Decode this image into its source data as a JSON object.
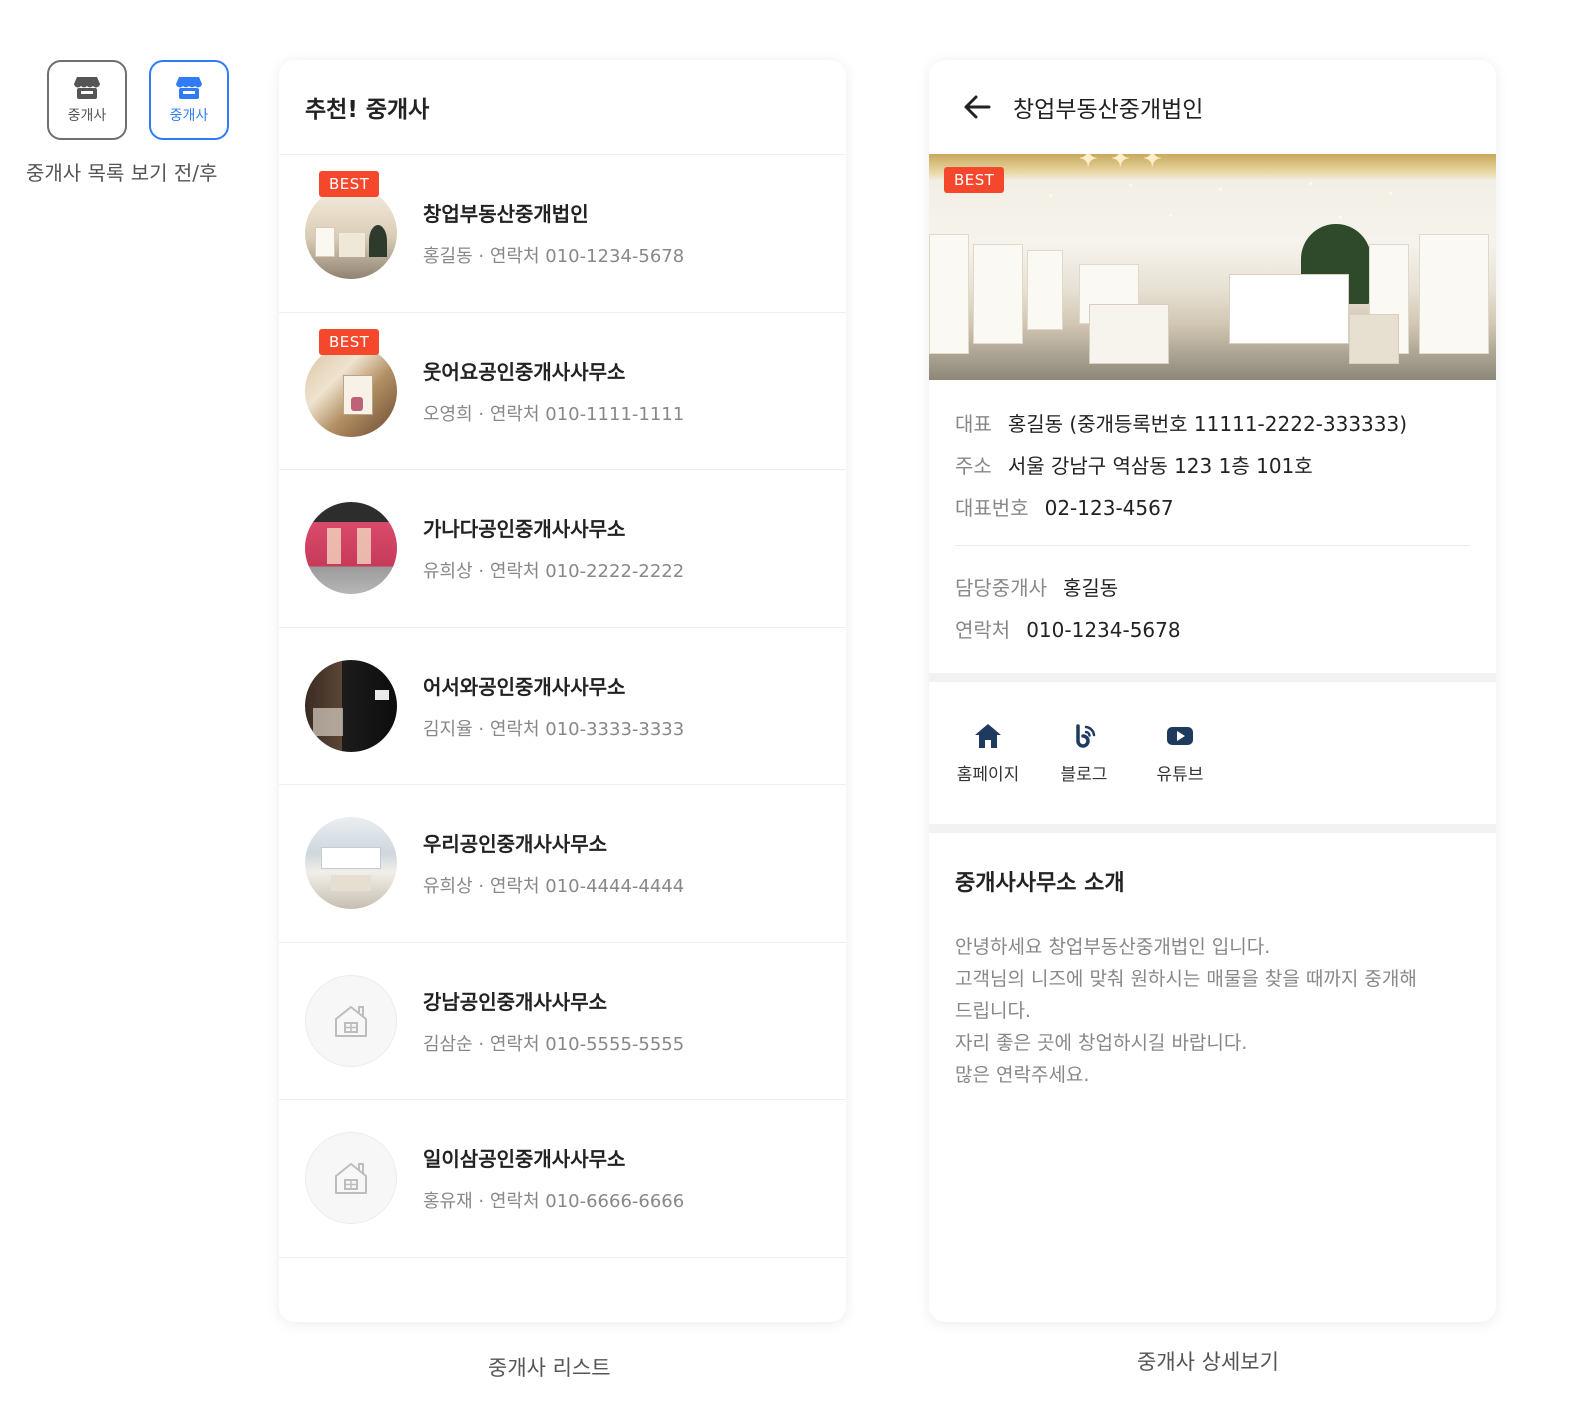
{
  "toggle": {
    "before_label": "중개사",
    "after_label": "중개사",
    "caption": "중개사 목록 보기 전/후",
    "icon": "store-icon",
    "active_color": "#2f7cf6"
  },
  "list_panel": {
    "title": "추천! 중개사",
    "caption": "중개사 리스트",
    "badge": "BEST",
    "badge_color": "#f5472c",
    "agents": [
      {
        "name": "창업부동산중개법인",
        "sub": "홍길동 · 연락처 010-1234-5678",
        "best": true
      },
      {
        "name": "웃어요공인중개사사무소",
        "sub": "오영희 · 연락처 010-1111-1111",
        "best": true
      },
      {
        "name": "가나다공인중개사사무소",
        "sub": "유희상 · 연락처 010-2222-2222",
        "best": false
      },
      {
        "name": "어서와공인중개사사무소",
        "sub": "김지율 · 연락처 010-3333-3333",
        "best": false
      },
      {
        "name": "우리공인중개사사무소",
        "sub": "유희상 · 연락처 010-4444-4444",
        "best": false
      },
      {
        "name": "강남공인중개사사무소",
        "sub": "김삼순 · 연락처 010-5555-5555",
        "best": false
      },
      {
        "name": "일이삼공인중개사사무소",
        "sub": "홍유재 · 연락처 010-6666-6666",
        "best": false
      }
    ]
  },
  "detail_panel": {
    "title": "창업부동산중개법인",
    "caption": "중개사 상세보기",
    "badge": "BEST",
    "info": {
      "rep_label": "대표",
      "rep_value": "홍길동 (중개등록번호 11111-2222-333333)",
      "addr_label": "주소",
      "addr_value": "서울 강남구 역삼동 123 1층 101호",
      "phone_label": "대표번호",
      "phone_value": "02-123-4567",
      "agent_label": "담당중개사",
      "agent_value": "홍길동",
      "contact_label": "연락처",
      "contact_value": "010-1234-5678"
    },
    "links": [
      {
        "label": "홈페이지",
        "icon": "home-icon"
      },
      {
        "label": "블로그",
        "icon": "blog-icon"
      },
      {
        "label": "유튜브",
        "icon": "youtube-icon"
      }
    ],
    "intro": {
      "title": "중개사사무소 소개",
      "lines": [
        "안녕하세요 창업부동산중개법인 입니다.",
        "고객님의 니즈에 맞춰 원하시는 매물을 찾을 때까지 중개해",
        "드립니다.",
        "자리 좋은 곳에 창업하시길 바랍니다.",
        "많은 연락주세요."
      ]
    }
  }
}
